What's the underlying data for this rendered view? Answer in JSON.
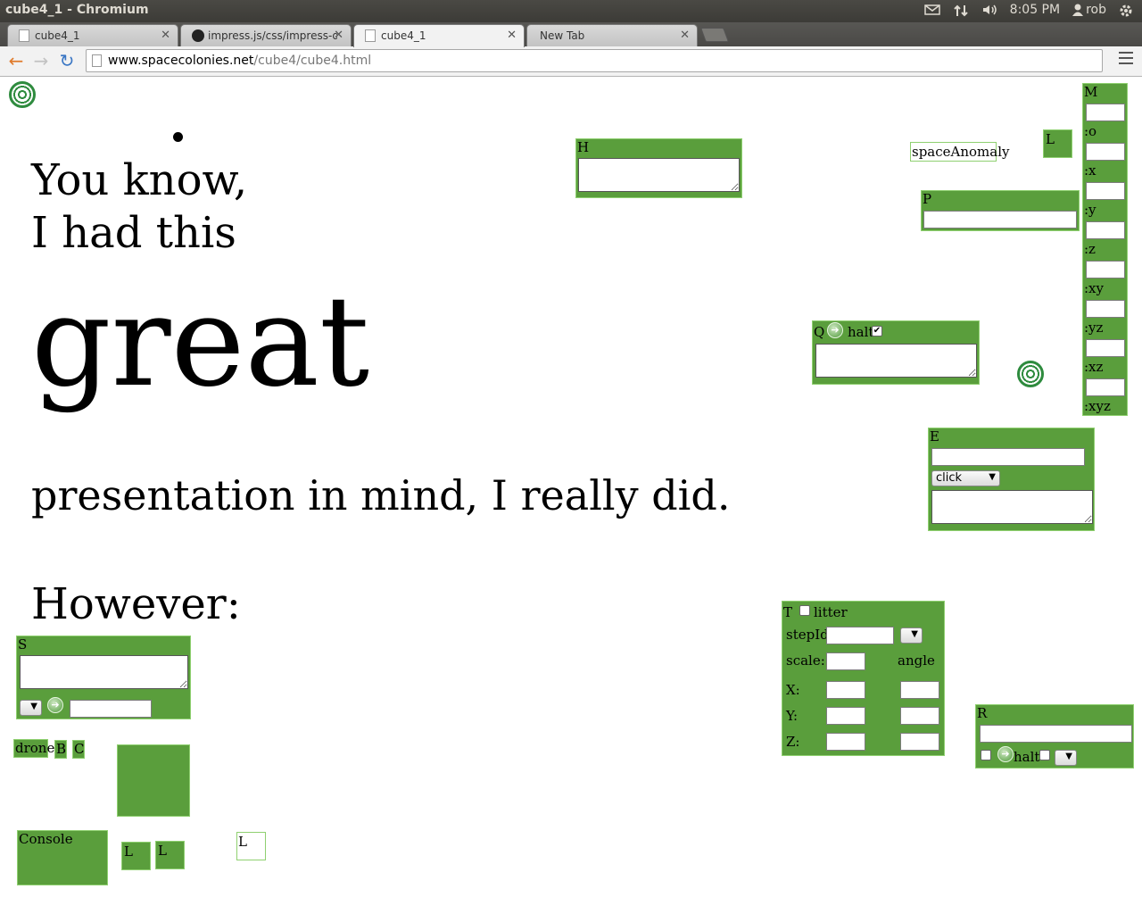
{
  "os_bar": {
    "window_title": "cube4_1 - Chromium",
    "clock": "8:05 PM",
    "user": "rob",
    "icons": [
      "mail-icon",
      "network-icon",
      "volume-icon",
      "user-icon",
      "power-gear-icon"
    ]
  },
  "tabs": [
    {
      "label": "cube4_1",
      "icon": "page-icon",
      "active": false
    },
    {
      "label": "impress.js/css/impress-de",
      "icon": "github-icon",
      "active": false
    },
    {
      "label": "cube4_1",
      "icon": "page-icon",
      "active": true
    },
    {
      "label": "New Tab",
      "icon": "",
      "active": false
    }
  ],
  "toolbar": {
    "url_host": "www.spacecolonies.net",
    "url_path": "/cube4/cube4.html"
  },
  "slide": {
    "line1": "You know,",
    "line2": "I had this",
    "big_word": "great",
    "line3": "presentation in mind, I really did.",
    "line4": "However:"
  },
  "panels": {
    "H": {
      "label": "H"
    },
    "L_top": {
      "label": "L"
    },
    "space_anomaly": {
      "label": "spaceAnomaly"
    },
    "P": {
      "label": "P"
    },
    "M": {
      "label": "M",
      "fields": [
        ":o",
        ":x",
        ":y",
        ":z",
        ":xy",
        ":yz",
        ":xz",
        ":xyz"
      ]
    },
    "Q": {
      "label": "Q",
      "halt_label": "halt",
      "halt_checked": true
    },
    "E": {
      "label": "E",
      "select_value": "click"
    },
    "S": {
      "label": "S"
    },
    "drone": {
      "label": "drone"
    },
    "B": {
      "label": "B"
    },
    "C": {
      "label": "C"
    },
    "console": {
      "label": "Console"
    },
    "L1": {
      "label": "L"
    },
    "L2": {
      "label": "L"
    },
    "L3": {
      "label": "L"
    },
    "T": {
      "label": "T",
      "litter_label": "litter",
      "stepId_label": "stepId",
      "scale_label": "scale:",
      "angle_label": "angle",
      "x_label": "X:",
      "y_label": "Y:",
      "z_label": "Z:"
    },
    "R": {
      "label": "R",
      "halt_label": "halt"
    }
  },
  "colors": {
    "panel_green": "#5a9e3c",
    "panel_border": "#8fd070",
    "spiral_green": "#2e8b3e"
  }
}
